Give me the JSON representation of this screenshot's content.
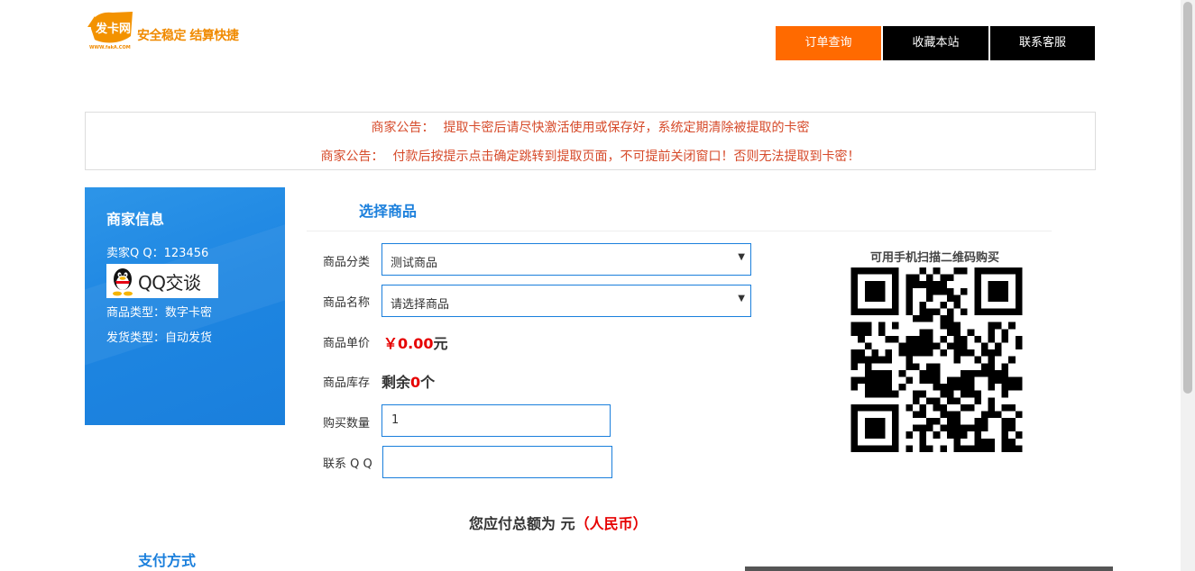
{
  "logo": {
    "mark_text": "发卡网",
    "slogan": "安全稳定 结算快捷",
    "url": "WWW.fakA.COM"
  },
  "nav": {
    "items": [
      {
        "label": "订单查询",
        "active": true
      },
      {
        "label": "收藏本站",
        "active": false
      },
      {
        "label": "联系客服",
        "active": false
      }
    ]
  },
  "notice": {
    "lines": [
      {
        "label": "商家公告：",
        "text": "提取卡密后请尽快激活使用或保存好，系统定期清除被提取的卡密"
      },
      {
        "label": "商家公告：",
        "text": "付款后按提示点击确定跳转到提取页面，不可提前关闭窗口！否则无法提取到卡密！"
      }
    ]
  },
  "merchant": {
    "title": "商家信息",
    "seller_qq_label": "卖家Q Q：",
    "seller_qq": "123456",
    "qq_button": "QQ交谈",
    "product_type_label": "商品类型：",
    "product_type": "数字卡密",
    "ship_type_label": "发货类型：",
    "ship_type": "自动发货"
  },
  "product": {
    "section_title": "选择商品",
    "category_label": "商品分类",
    "category_value": "测试商品",
    "name_label": "商品名称",
    "name_value": "请选择商品",
    "price_label": "商品单价",
    "price_value": "￥0.00",
    "price_unit": "元",
    "stock_label": "商品库存",
    "stock_prefix": "剩余",
    "stock_count": "0",
    "stock_suffix": "个",
    "qty_label": "购买数量",
    "qty_value": "1",
    "contact_label": "联系 Q Q",
    "contact_value": ""
  },
  "qr": {
    "tip": "可用手机扫描二维码购买"
  },
  "total": {
    "prefix": "您应付总额为 元",
    "currency": "（人民币）"
  },
  "payment": {
    "title": "支付方式"
  },
  "colors": {
    "accent_orange": "#ff6a00",
    "primary_blue": "#1a7fdc",
    "notice_red": "#d64a2a",
    "price_red": "#e60000"
  }
}
